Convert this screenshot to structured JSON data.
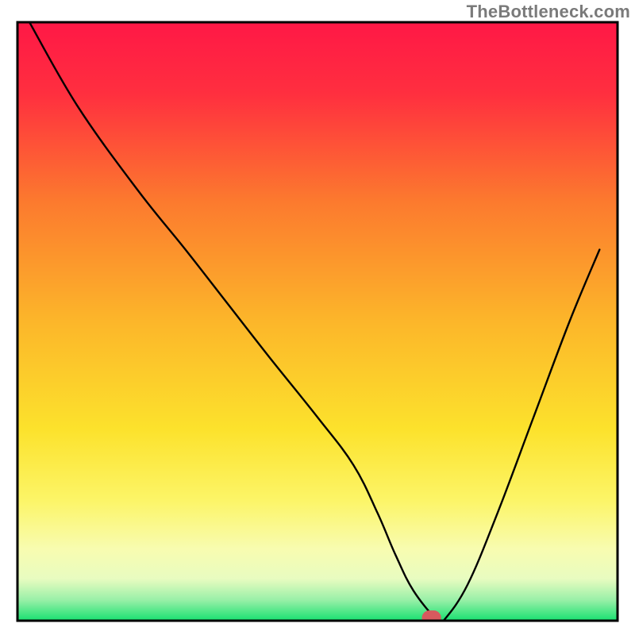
{
  "watermark": "TheBottleneck.com",
  "chart_data": {
    "type": "line",
    "title": "",
    "xlabel": "",
    "ylabel": "",
    "xlim": [
      0,
      100
    ],
    "ylim": [
      0,
      100
    ],
    "grid": false,
    "legend": false,
    "gradient_stops": [
      {
        "offset": 0.0,
        "color": "#ff1846"
      },
      {
        "offset": 0.12,
        "color": "#ff2f3f"
      },
      {
        "offset": 0.3,
        "color": "#fc7a2e"
      },
      {
        "offset": 0.5,
        "color": "#fcb62a"
      },
      {
        "offset": 0.68,
        "color": "#fce22c"
      },
      {
        "offset": 0.8,
        "color": "#fcf568"
      },
      {
        "offset": 0.88,
        "color": "#f8fcb0"
      },
      {
        "offset": 0.93,
        "color": "#e8fcc0"
      },
      {
        "offset": 0.965,
        "color": "#9af0a8"
      },
      {
        "offset": 1.0,
        "color": "#18e070"
      }
    ],
    "series": [
      {
        "name": "bottleneck-curve",
        "x": [
          2,
          10,
          20,
          28,
          35,
          42,
          50,
          56,
          60,
          63,
          66,
          70,
          71,
          75,
          80,
          86,
          92,
          97
        ],
        "y": [
          100,
          86,
          72,
          62,
          53,
          44,
          34,
          26,
          18,
          11,
          5,
          0,
          0,
          6,
          18,
          34,
          50,
          62
        ]
      }
    ],
    "marker": {
      "name": "target-pill",
      "x": 69,
      "y": 0.5,
      "width": 3.2,
      "height": 2.4,
      "color": "#d85a5e"
    },
    "frame": {
      "stroke": "#000000",
      "width": 3
    }
  }
}
